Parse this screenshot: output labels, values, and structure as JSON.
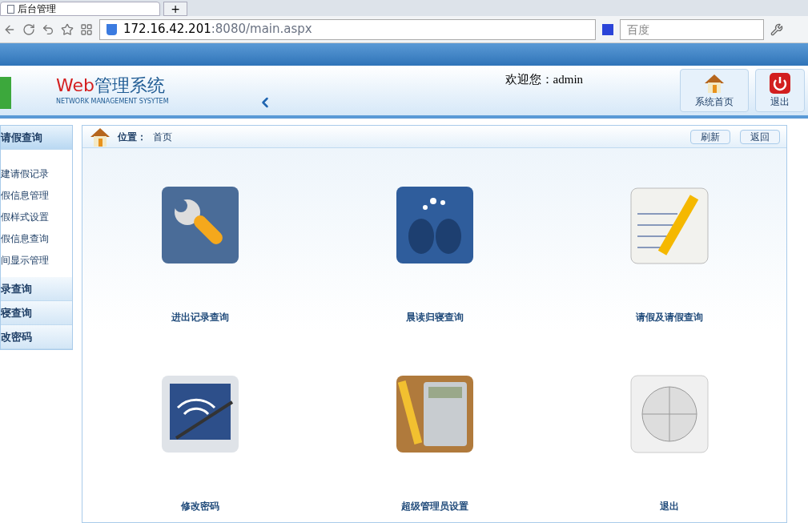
{
  "browser": {
    "tab_title": "后台管理",
    "new_tab": "+",
    "url_host": "172.16.42.201",
    "url_rest": ":8080/main.aspx",
    "search_placeholder": "百度"
  },
  "header": {
    "logo_main": "Web",
    "logo_cn": "管理系统",
    "logo_sub": "NETWORK MANAGEMENT SYSYTEM",
    "welcome": "欢迎您：",
    "user": "admin",
    "buttons": [
      {
        "kind": "home",
        "label": "系统首页"
      },
      {
        "kind": "power",
        "label": "退出"
      }
    ]
  },
  "sidebar": {
    "groups": [
      {
        "title": "请假查询",
        "expanded": true,
        "items": [
          "建请假记录",
          "假信息管理",
          "假样式设置",
          "假信息查询",
          "间显示管理"
        ]
      },
      {
        "title": "录查询",
        "expanded": false
      },
      {
        "title": "寝查询",
        "expanded": false
      },
      {
        "title": "改密码",
        "expanded": false
      }
    ]
  },
  "breadcrumb": {
    "label": "位置：",
    "current": "首页",
    "actions": [
      "刷新",
      "返回"
    ]
  },
  "tiles": [
    {
      "kind": "wrench",
      "label": "进出记录查询"
    },
    {
      "kind": "faces",
      "label": "晨读归寝查询"
    },
    {
      "kind": "notepad",
      "label": "请假及请假查询"
    },
    {
      "kind": "tablet",
      "label": "修改密码"
    },
    {
      "kind": "calculator",
      "label": "超级管理员设置"
    },
    {
      "kind": "globe",
      "label": "退出"
    }
  ]
}
